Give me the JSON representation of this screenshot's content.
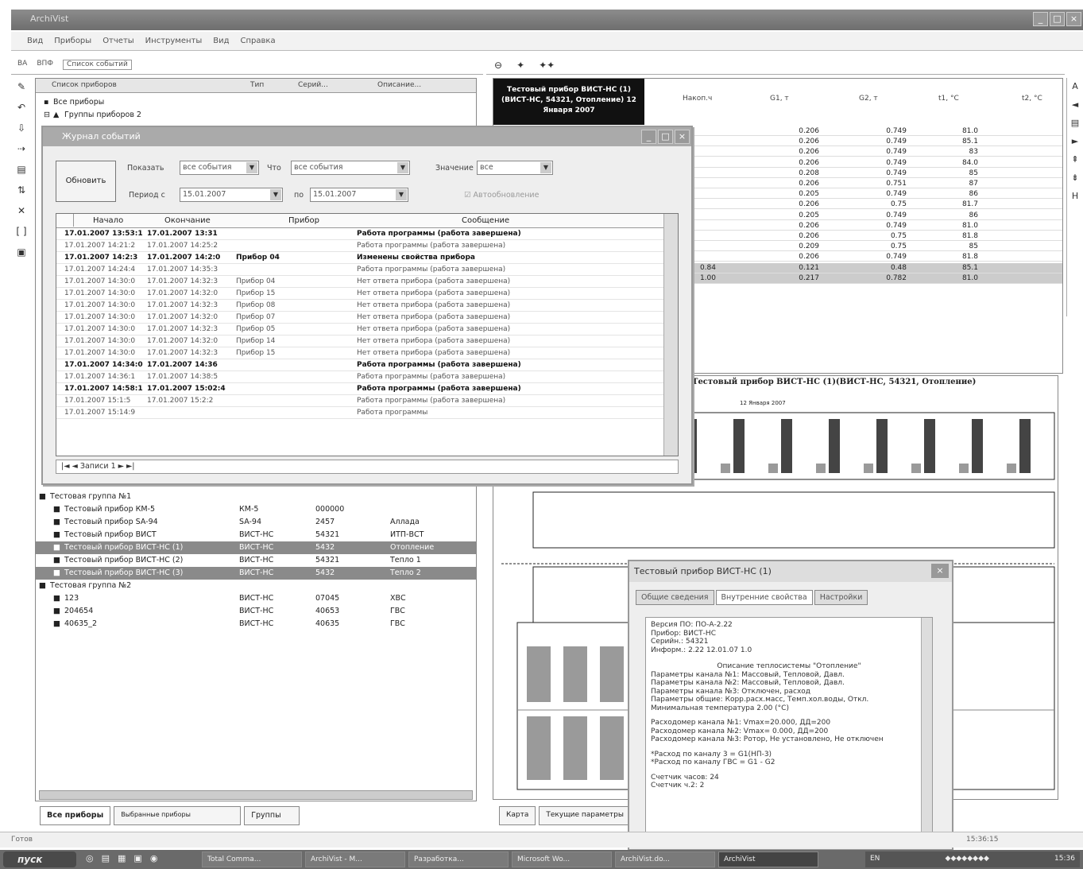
{
  "app": {
    "title": "ArchiVist"
  },
  "menu": [
    "Вид",
    "Приборы",
    "Отчеты",
    "Инструменты",
    "Вид",
    "Справка"
  ],
  "left_toolbar": {
    "b1": "ВА",
    "b2": "ВПФ",
    "show_chk": "Список событий"
  },
  "vtools": [
    "icon1",
    "icon2",
    "icon3",
    "icon4",
    "icon5",
    "icon6",
    "icon7",
    "icon8",
    "icon9"
  ],
  "tree": {
    "headers": {
      "list": "Список приборов",
      "type": "Тип",
      "ser": "Серий...",
      "desc": "Описание..."
    },
    "rows": [
      {
        "indent": 4,
        "name": "Все приборы"
      },
      {
        "indent": 14,
        "name": "Группы приборов 2"
      }
    ],
    "rows2": [
      {
        "indent": 12,
        "name": "Тестовая группа №1",
        "type": "",
        "ser": "",
        "desc": "",
        "sel": false
      },
      {
        "indent": 30,
        "name": "Тестовый прибор КМ-5",
        "type": "КМ-5",
        "ser": "000000",
        "desc": "",
        "sel": false
      },
      {
        "indent": 30,
        "name": "Тестовый прибор SA-94",
        "type": "SA-94",
        "ser": "2457",
        "desc": "Аллада",
        "sel": false
      },
      {
        "indent": 30,
        "name": "Тестовый прибор ВИСТ",
        "type": "ВИСТ-НС",
        "ser": "54321",
        "desc": "ИТП-ВСТ",
        "sel": false
      },
      {
        "indent": 30,
        "name": "Тестовый прибор ВИСТ-НС (1)",
        "type": "ВИСТ-НС",
        "ser": "5432",
        "desc": "Отопление",
        "sel": true
      },
      {
        "indent": 30,
        "name": "Тестовый прибор ВИСТ-НС (2)",
        "type": "ВИСТ-НС",
        "ser": "54321",
        "desc": "Тепло 1",
        "sel": false
      },
      {
        "indent": 30,
        "name": "Тестовый прибор ВИСТ-НС (3)",
        "type": "ВИСТ-НС",
        "ser": "5432",
        "desc": "Тепло 2",
        "sel": true
      },
      {
        "indent": 12,
        "name": "Тестовая группа №2",
        "type": "",
        "ser": "",
        "desc": "",
        "sel": false
      },
      {
        "indent": 30,
        "name": "123",
        "type": "ВИСТ-НС",
        "ser": "07045",
        "desc": "ХВС",
        "sel": false
      },
      {
        "indent": 30,
        "name": "204654",
        "type": "ВИСТ-НС",
        "ser": "40653",
        "desc": "ГВС",
        "sel": false
      },
      {
        "indent": 30,
        "name": "40635_2",
        "type": "ВИСТ-НС",
        "ser": "40635",
        "desc": "ГВС",
        "sel": false
      }
    ]
  },
  "left_tabs": [
    "Все приборы",
    "Выбранные приборы",
    "Группы"
  ],
  "dialog": {
    "title": "Журнал событий",
    "refresh": "Обновить",
    "show_lbl": "Показать",
    "show_val": "все события",
    "what_lbl": "Что",
    "what_val": "все события",
    "val_lbl": "Значение",
    "val_val": "все",
    "period_lbl": "Период с",
    "from": "15.01.2007",
    "to_lbl": "по",
    "to": "15.01.2007",
    "auto": "Автообновление",
    "headers": {
      "start": "Начало",
      "end": "Окончание",
      "device": "Прибор",
      "msg": "Сообщение"
    },
    "rows": [
      {
        "start": "17.01.2007 13:53:1",
        "end": "17.01.2007 13:31",
        "device": "",
        "msg": "Работа программы (работа завершена)",
        "bold": true
      },
      {
        "start": "17.01.2007 14:21:2",
        "end": "17.01.2007 14:25:2",
        "device": "",
        "msg": "Работа программы (работа завершена)",
        "bold": false
      },
      {
        "start": "17.01.2007 14:2:3",
        "end": "17.01.2007 14:2:0",
        "device": "Прибор 04",
        "msg": "Изменены свойства прибора",
        "bold": true
      },
      {
        "start": "17.01.2007 14:24:4",
        "end": "17.01.2007 14:35:3",
        "device": "",
        "msg": "Работа программы (работа завершена)",
        "bold": false
      },
      {
        "start": "17.01.2007 14:30:0",
        "end": "17.01.2007 14:32:3",
        "device": "Прибор 04",
        "msg": "Нет ответа прибора (работа завершена)",
        "bold": false
      },
      {
        "start": "17.01.2007 14:30:0",
        "end": "17.01.2007 14:32:0",
        "device": "Прибор 15",
        "msg": "Нет ответа прибора (работа завершена)",
        "bold": false
      },
      {
        "start": "17.01.2007 14:30:0",
        "end": "17.01.2007 14:32:3",
        "device": "Прибор 08",
        "msg": "Нет ответа прибора (работа завершена)",
        "bold": false
      },
      {
        "start": "17.01.2007 14:30:0",
        "end": "17.01.2007 14:32:0",
        "device": "Прибор 07",
        "msg": "Нет ответа прибора (работа завершена)",
        "bold": false
      },
      {
        "start": "17.01.2007 14:30:0",
        "end": "17.01.2007 14:32:3",
        "device": "Прибор 05",
        "msg": "Нет ответа прибора (работа завершена)",
        "bold": false
      },
      {
        "start": "17.01.2007 14:30:0",
        "end": "17.01.2007 14:32:0",
        "device": "Прибор 14",
        "msg": "Нет ответа прибора (работа завершена)",
        "bold": false
      },
      {
        "start": "17.01.2007 14:30:0",
        "end": "17.01.2007 14:32:3",
        "device": "Прибор 15",
        "msg": "Нет ответа прибора (работа завершена)",
        "bold": false
      },
      {
        "start": "17.01.2007 14:34:0",
        "end": "17.01.2007 14:36",
        "device": "",
        "msg": "Работа программы (работа завершена)",
        "bold": true
      },
      {
        "start": "17.01.2007 14:36:1",
        "end": "17.01.2007 14:38:5",
        "device": "",
        "msg": "Работа программы (работа завершена)",
        "bold": false
      },
      {
        "start": "17.01.2007 14:58:1",
        "end": "17.01.2007 15:02:4",
        "device": "",
        "msg": "Работа программы (работа завершена)",
        "bold": true
      },
      {
        "start": "17.01.2007 15:1:5",
        "end": "17.01.2007 15:2:2",
        "device": "",
        "msg": "Работа программы (работа завершена)",
        "bold": false
      },
      {
        "start": "17.01.2007 15:14:9",
        "end": "",
        "device": "",
        "msg": "Работа программы",
        "bold": false
      }
    ],
    "pager": "Записи 1"
  },
  "right_toolbar": [
    "zoom-icon",
    "view1",
    "view2"
  ],
  "grid": {
    "device": "Тестовый прибор ВИСТ-НС (1) (ВИСТ-НС, 54321, Отопление) 12 Января 2007",
    "cols": [
      "Накоп.ч",
      "G1, т",
      "G2, т",
      "t1, °C",
      "t2, °C"
    ],
    "rows": [
      [
        "",
        "0.206",
        "0.749",
        "81.0"
      ],
      [
        "",
        "0.206",
        "0.749",
        "85.1"
      ],
      [
        "",
        "0.206",
        "0.749",
        "83"
      ],
      [
        "",
        "0.206",
        "0.749",
        "84.0"
      ],
      [
        "",
        "0.208",
        "0.749",
        "85"
      ],
      [
        "",
        "0.206",
        "0.751",
        "87"
      ],
      [
        "",
        "0.205",
        "0.749",
        "86"
      ],
      [
        "",
        "0.206",
        "0.75",
        "81.7"
      ],
      [
        "",
        "0.205",
        "0.749",
        "86"
      ],
      [
        "",
        "0.206",
        "0.749",
        "81.0"
      ],
      [
        "",
        "0.206",
        "0.75",
        "81.8"
      ],
      [
        "",
        "0.209",
        "0.75",
        "85"
      ],
      [
        "",
        "0.206",
        "0.749",
        "81.8"
      ]
    ],
    "totals": [
      [
        "0.84",
        "0.121",
        "0.48",
        "85.1"
      ],
      [
        "1.00",
        "0.217",
        "0.782",
        "81.0"
      ]
    ]
  },
  "chart": {
    "title": "Тестовый прибор ВИСТ-НС (1)(ВИСТ-НС, 54321, Отопление)",
    "subtitle": "12 Января 2007"
  },
  "right_tabs": [
    "Карта",
    "Текущие параметры"
  ],
  "props": {
    "title": "Тестовый прибор ВИСТ-НС (1)",
    "tabs": [
      "Общие сведения",
      "Внутренние свойства",
      "Настройки"
    ],
    "lines": [
      "Версия ПО: ПО-А-2.22",
      "Прибор: ВИСТ-НС",
      "Серийн.: 54321",
      "Информ.: 2.22 12.01.07 1.0"
    ],
    "center": "Описание теплосистемы \"Отопление\"",
    "lines2": [
      "Параметры канала №1: Массовый, Тепловой, Давл.",
      "Параметры канала №2: Массовый, Тепловой, Давл.",
      "Параметры канала №3: Отключен, расход",
      "Параметры общие: Корр.расх.масс, Темп.хол.воды, Откл.",
      "Минимальная температура 2.00 (°C)"
    ],
    "lines3": [
      "Расходомер канала №1: Vmax=20.000, ДД=200",
      "Расходомер канала №2: Vmax= 0.000, ДД=200",
      "Расходомер канала №3: Ротор, Не установлено, Не отключен"
    ],
    "lines4": [
      "*Расход по каналу 3 = G1(НП-3)",
      "*Расход по каналу ГВС = G1 - G2"
    ],
    "lines5": [
      "Счетчик часов: 24",
      "Счетчик ч.2: 2"
    ]
  },
  "status": {
    "left": "Готов",
    "time": "15:36:15"
  },
  "taskbar": {
    "start": "пуск",
    "quick": [
      "ie-icon",
      "folder-icon",
      "win-icon",
      "doc-icon",
      "media-icon"
    ],
    "buttons": [
      "Total Comma...",
      "ArchiVist - M...",
      "Разработка...",
      "Microsoft Wo...",
      "ArchiVist.do...",
      "ArchiVist"
    ],
    "lang": "EN",
    "clock": "15:36"
  },
  "colors": {
    "selected_row": "#8a8a8a",
    "device_header": "#111111",
    "bar_dark": "#444444",
    "bar_light": "#9a9a9a"
  }
}
